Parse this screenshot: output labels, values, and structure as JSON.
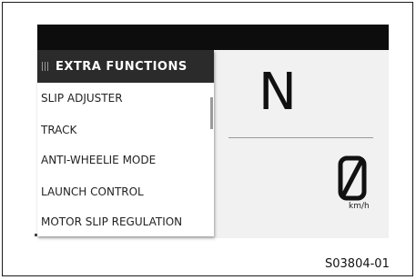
{
  "menu": {
    "title": "EXTRA FUNCTIONS",
    "items": [
      {
        "label": "SLIP ADJUSTER"
      },
      {
        "label": "TRACK"
      },
      {
        "label": "ANTI-WHEELIE MODE"
      },
      {
        "label": "LAUNCH CONTROL"
      },
      {
        "label": "MOTOR SLIP REGULATION"
      }
    ]
  },
  "dashboard": {
    "gear": "N",
    "speed": "0",
    "speed_unit": "km/h"
  },
  "figure_ref": "S03804-01"
}
